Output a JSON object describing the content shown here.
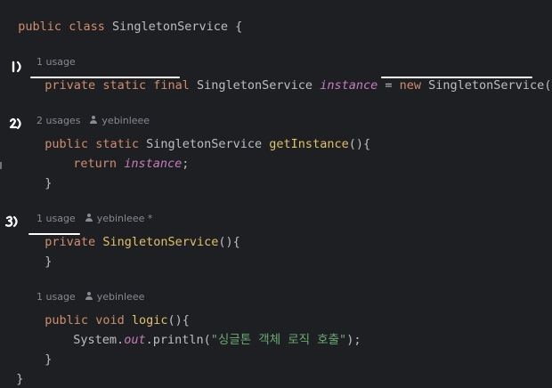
{
  "code": {
    "class_decl": {
      "kw1": "public",
      "kw2": "class",
      "name": "SingletonService",
      "brace": " {"
    },
    "field_line": {
      "kw1": "private",
      "kw2": "static",
      "kw3": "final",
      "type": "SingletonService",
      "name": "instance",
      "eq": " = ",
      "kw_new": "new",
      "ctor": "SingletonService",
      "tail": "();"
    },
    "get_instance_line": {
      "kw1": "public",
      "kw2": "static",
      "type": "SingletonService",
      "name": "getInstance",
      "tail": "(){"
    },
    "return_line": {
      "kw": "return",
      "name": "instance",
      "semi": ";"
    },
    "close_brace": "}",
    "ctor_line": {
      "kw": "private",
      "name": "SingletonService",
      "tail": "(){"
    },
    "logic_line": {
      "kw1": "public",
      "kw2": "void",
      "name": "logic",
      "tail": "(){"
    },
    "println_line": {
      "obj": "System",
      "dot1": ".",
      "field": "out",
      "dot2": ".",
      "method": "println",
      "open": "(",
      "str": "\"싱글톤 객체 로직 호출\"",
      "close": ");"
    }
  },
  "hints": {
    "field_usage": "1 usage",
    "get_instance_usage": "2 usages",
    "get_instance_author": "yebinleee",
    "ctor_usage": "1 usage",
    "ctor_author": "yebinleee *",
    "logic_usage": "1 usage",
    "logic_author": "yebinleee"
  },
  "annotations": {
    "mark1": "1)",
    "mark2": "2)",
    "mark3": "3)"
  },
  "colors": {
    "background": "#1e1f22",
    "keyword": "#cf8e6d",
    "method_decl": "#56a8f5",
    "field": "#c77dbb",
    "string": "#6aab73",
    "text": "#bcbec4",
    "hint": "#868a91",
    "annotation": "#ffffff"
  }
}
